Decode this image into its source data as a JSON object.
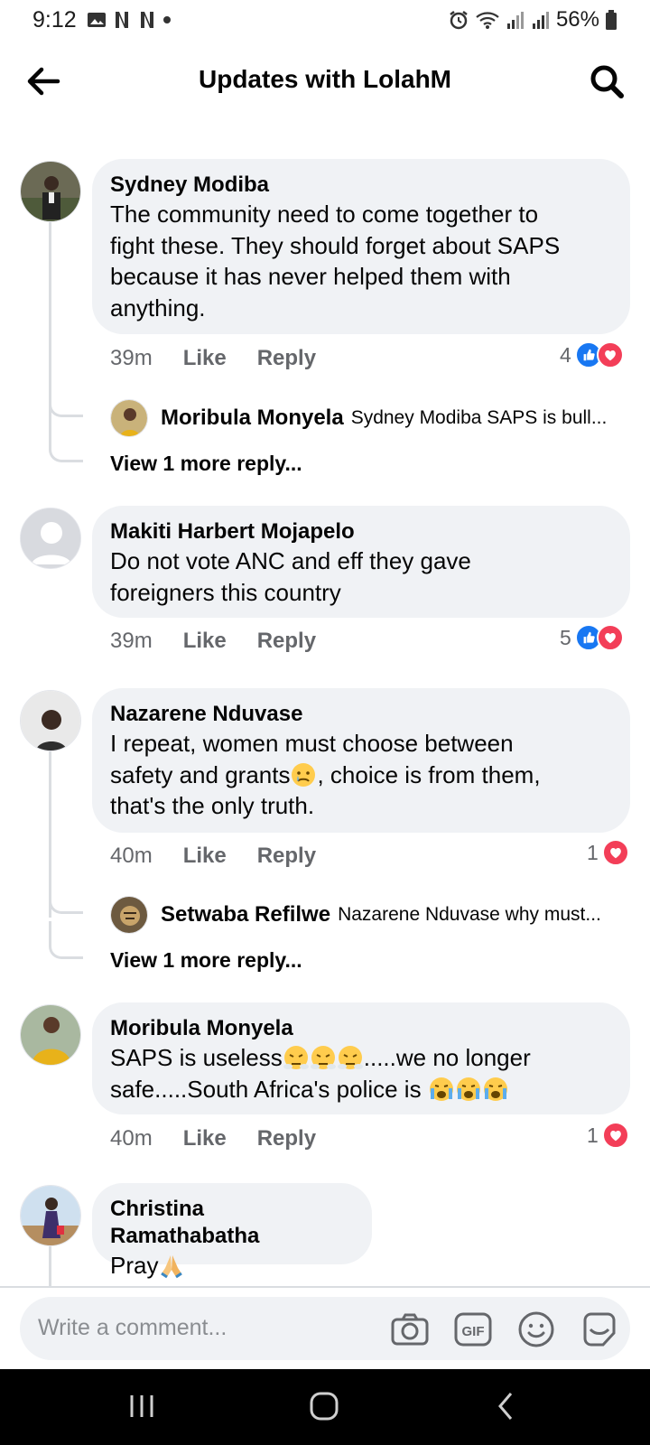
{
  "status_bar": {
    "time": "9:12",
    "battery": "56%"
  },
  "header": {
    "title": "Updates with LolahM",
    "back_icon": "arrow-left-icon",
    "search_icon": "search-icon"
  },
  "comments": [
    {
      "author": "Sydney Modiba",
      "lines": [
        "The community need to come together to",
        "fight these. They should forget about SAPS",
        "because it has never helped them with",
        "anything."
      ],
      "time": "39m",
      "like": "Like",
      "reply": "Reply",
      "reaction_count": "4",
      "reply_preview": {
        "author": "Moribula Monyela",
        "text": "Sydney Modiba SAPS is bull..."
      },
      "view_more": "View 1 more reply..."
    },
    {
      "author": "Makiti Harbert Mojapelo",
      "lines": [
        "Do not vote ANC and eff they gave",
        "foreigners this country"
      ],
      "time": "39m",
      "like": "Like",
      "reply": "Reply",
      "reaction_count": "5"
    },
    {
      "author": "Nazarene Nduvase",
      "line1": "I repeat, women must choose between",
      "line2_a": "safety and grants",
      "line2_b": ", choice is from them,",
      "line3": "that's the only truth.",
      "time": "40m",
      "like": "Like",
      "reply": "Reply",
      "reaction_count": "1",
      "reply_preview": {
        "author": "Setwaba Refilwe",
        "text": "Nazarene Nduvase why must..."
      },
      "view_more": "View 1 more reply..."
    },
    {
      "author": "Moribula Monyela",
      "line1_a": "SAPS is useless",
      "line1_b": ".....we no longer",
      "line2_a": "safe.....South Africa's police is ",
      "time": "40m",
      "like": "Like",
      "reply": "Reply",
      "reaction_count": "1"
    },
    {
      "author": "Christina Ramathabatha",
      "text": "Pray"
    }
  ],
  "composer": {
    "placeholder": "Write a comment..."
  },
  "colors": {
    "like_blue": "#1877f2",
    "love_red": "#f33e58",
    "bubble": "#f0f2f5",
    "meta_gray": "#65676b"
  }
}
